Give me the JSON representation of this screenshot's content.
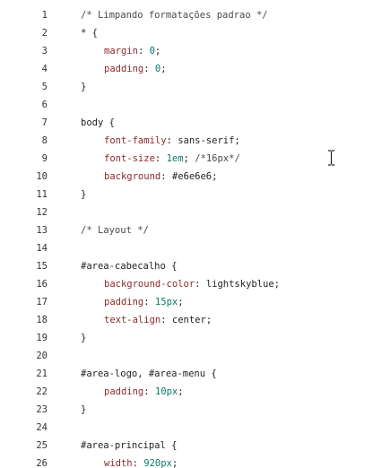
{
  "lines": [
    {
      "num": "1",
      "parts": [
        {
          "t": "/* Limpando formatações padrao */",
          "k": "comment"
        }
      ]
    },
    {
      "num": "2",
      "parts": [
        {
          "t": "* {",
          "k": "sel"
        }
      ]
    },
    {
      "num": "3",
      "indent": 1,
      "parts": [
        {
          "t": "margin",
          "k": "prop"
        },
        {
          "t": ": ",
          "k": "punct"
        },
        {
          "t": "0",
          "k": "num"
        },
        {
          "t": ";",
          "k": "punct"
        }
      ]
    },
    {
      "num": "4",
      "indent": 1,
      "parts": [
        {
          "t": "padding",
          "k": "prop"
        },
        {
          "t": ": ",
          "k": "punct"
        },
        {
          "t": "0",
          "k": "num"
        },
        {
          "t": ";",
          "k": "punct"
        }
      ]
    },
    {
      "num": "5",
      "parts": [
        {
          "t": "}",
          "k": "punct"
        }
      ]
    },
    {
      "num": "6",
      "parts": []
    },
    {
      "num": "7",
      "parts": [
        {
          "t": "body {",
          "k": "sel"
        }
      ]
    },
    {
      "num": "8",
      "indent": 1,
      "parts": [
        {
          "t": "font-family",
          "k": "prop"
        },
        {
          "t": ": ",
          "k": "punct"
        },
        {
          "t": "sans-serif",
          "k": "val"
        },
        {
          "t": ";",
          "k": "punct"
        }
      ]
    },
    {
      "num": "9",
      "indent": 1,
      "parts": [
        {
          "t": "font-size",
          "k": "prop"
        },
        {
          "t": ": ",
          "k": "punct"
        },
        {
          "t": "1em",
          "k": "num"
        },
        {
          "t": "; ",
          "k": "punct"
        },
        {
          "t": "/*16px*/",
          "k": "comment"
        }
      ]
    },
    {
      "num": "10",
      "indent": 1,
      "parts": [
        {
          "t": "background",
          "k": "prop"
        },
        {
          "t": ": ",
          "k": "punct"
        },
        {
          "t": "#e6e6e6",
          "k": "val"
        },
        {
          "t": ";",
          "k": "punct"
        }
      ]
    },
    {
      "num": "11",
      "parts": [
        {
          "t": "}",
          "k": "punct"
        }
      ]
    },
    {
      "num": "12",
      "parts": []
    },
    {
      "num": "13",
      "parts": [
        {
          "t": "/* Layout */",
          "k": "comment"
        }
      ]
    },
    {
      "num": "14",
      "parts": []
    },
    {
      "num": "15",
      "parts": [
        {
          "t": "#area-cabecalho {",
          "k": "sel"
        }
      ]
    },
    {
      "num": "16",
      "indent": 1,
      "parts": [
        {
          "t": "background-color",
          "k": "prop"
        },
        {
          "t": ": ",
          "k": "punct"
        },
        {
          "t": "lightskyblue",
          "k": "val"
        },
        {
          "t": ";",
          "k": "punct"
        }
      ]
    },
    {
      "num": "17",
      "indent": 1,
      "parts": [
        {
          "t": "padding",
          "k": "prop"
        },
        {
          "t": ": ",
          "k": "punct"
        },
        {
          "t": "15px",
          "k": "num"
        },
        {
          "t": ";",
          "k": "punct"
        }
      ]
    },
    {
      "num": "18",
      "indent": 1,
      "parts": [
        {
          "t": "text-align",
          "k": "prop"
        },
        {
          "t": ": ",
          "k": "punct"
        },
        {
          "t": "center",
          "k": "val"
        },
        {
          "t": ";",
          "k": "punct"
        }
      ]
    },
    {
      "num": "19",
      "parts": [
        {
          "t": "}",
          "k": "punct"
        }
      ]
    },
    {
      "num": "20",
      "parts": []
    },
    {
      "num": "21",
      "parts": [
        {
          "t": "#area-logo, #area-menu {",
          "k": "sel"
        }
      ]
    },
    {
      "num": "22",
      "indent": 1,
      "parts": [
        {
          "t": "padding",
          "k": "prop"
        },
        {
          "t": ": ",
          "k": "punct"
        },
        {
          "t": "10px",
          "k": "num"
        },
        {
          "t": ";",
          "k": "punct"
        }
      ]
    },
    {
      "num": "23",
      "parts": [
        {
          "t": "}",
          "k": "punct"
        }
      ]
    },
    {
      "num": "24",
      "parts": []
    },
    {
      "num": "25",
      "parts": [
        {
          "t": "#area-principal {",
          "k": "sel"
        }
      ]
    },
    {
      "num": "26",
      "indent": 1,
      "parts": [
        {
          "t": "width",
          "k": "prop"
        },
        {
          "t": ": ",
          "k": "punct"
        },
        {
          "t": "920px",
          "k": "num"
        },
        {
          "t": ";",
          "k": "punct"
        }
      ]
    }
  ],
  "cursor_icon": "text-cursor-icon"
}
